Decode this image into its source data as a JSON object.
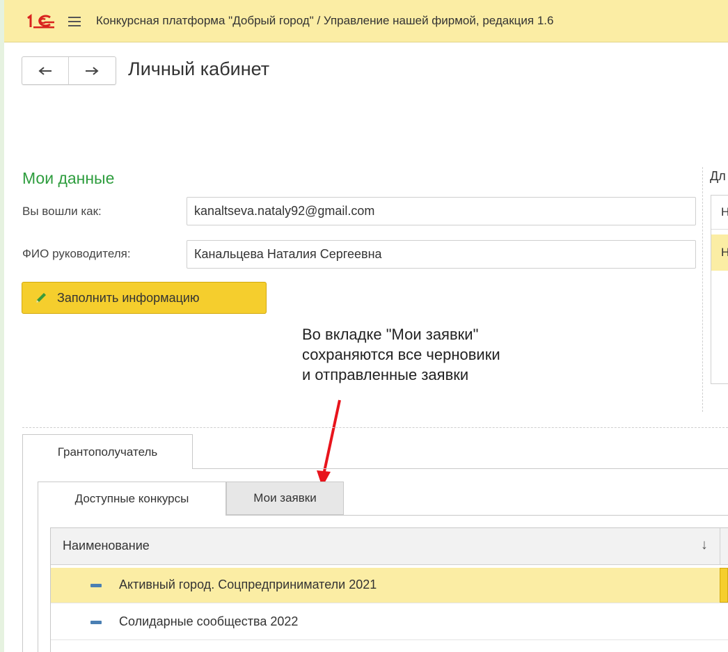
{
  "app": {
    "title": "Конкурсная платформа \"Добрый город\" / Управление нашей фирмой, редакция 1.6"
  },
  "page": {
    "title": "Личный кабинет"
  },
  "my_data": {
    "section_title": "Мои данные",
    "login_label": "Вы вошли как:",
    "login_value": "kanaltseva.nataly92@gmail.com",
    "fio_label": "ФИО руководителя:",
    "fio_value": "Канальцева Наталия Сергеевна",
    "fill_button": "Заполнить информацию"
  },
  "right_panel": {
    "label": "Дл",
    "rows": [
      "Н",
      "Н"
    ]
  },
  "annotation": {
    "lines": [
      "Во вкладке \"Мои заявки\"",
      "сохраняются все черновики",
      "и отправленные заявки"
    ],
    "color": "#e8141c"
  },
  "tabs": {
    "outer": "Грантополучатель",
    "sub": [
      "Доступные конкурсы",
      "Мои заявки"
    ]
  },
  "table": {
    "header": "Наименование",
    "sort_icon": "↓",
    "rows": [
      "Активный город. Соцпредприниматели 2021",
      "Солидарные сообщества 2022"
    ]
  },
  "colors": {
    "topbar": "#fbeda4",
    "accent_green": "#2e9d3e",
    "button_yellow": "#f5ce2d",
    "selected_row": "#fbeda4"
  }
}
